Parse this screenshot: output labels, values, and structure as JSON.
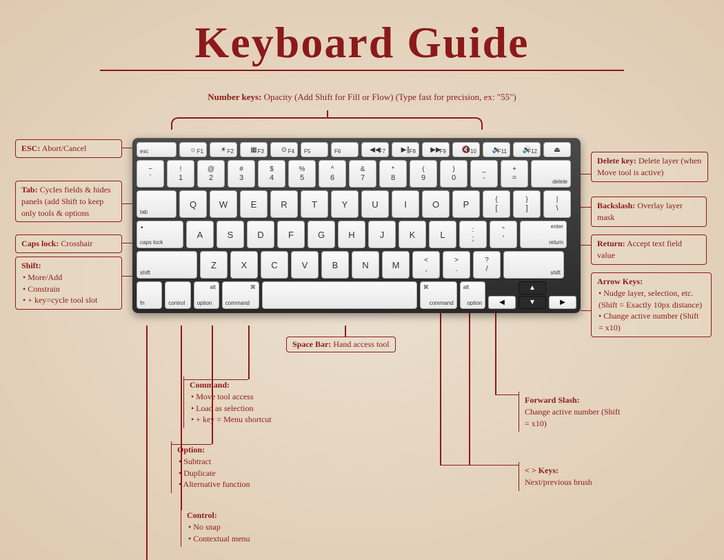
{
  "title": "Keyboard Guide",
  "number_keys": {
    "label": "Number keys:",
    "desc": "Opacity (Add Shift for Fill or Flow) (Type fast for precision, ex: \"55\")"
  },
  "callouts": {
    "esc": {
      "label": "ESC:",
      "desc": "Abort/Cancel"
    },
    "tab": {
      "label": "Tab:",
      "desc": "Cycles fields & hides panels (add Shift to keep only tools & options"
    },
    "caps": {
      "label": "Caps lock:",
      "desc": "Crosshair"
    },
    "shift": {
      "label": "Shift:",
      "items": [
        "More/Add",
        "Constrain",
        "+ key=cycle tool slot"
      ]
    },
    "command": {
      "label": "Command:",
      "items": [
        "Move tool access",
        "Load as selection",
        "+ key = Menu shortcut"
      ]
    },
    "option": {
      "label": "Option:",
      "items": [
        "Subtract",
        "Duplicate",
        "Alternative function"
      ]
    },
    "control": {
      "label": "Control:",
      "items": [
        "No snap",
        "Contextual menu"
      ]
    },
    "delete": {
      "label": "Delete key:",
      "desc": "Delete layer (when Move tool is active)"
    },
    "backslash": {
      "label": "Backslash:",
      "desc": "Overlay layer mask"
    },
    "return": {
      "label": "Return:",
      "desc": "Accept text field value"
    },
    "arrows": {
      "label": "Arrow Keys:",
      "items": [
        "Nudge layer, selection, etc. (Shift = Exactly 10px distance)",
        "Change active number (Shift = x10)"
      ]
    },
    "fslash": {
      "label": "Forward Slash:",
      "desc": "Change active number (Shift = x10)"
    },
    "angle": {
      "label": "< > Keys:",
      "desc": "Next/previous brush"
    },
    "space": {
      "label": "Space Bar:",
      "desc": "Hand access tool"
    }
  },
  "frow": [
    {
      "name": "esc",
      "label": "esc"
    },
    {
      "name": "f1",
      "sym": "☼",
      "label": "F1"
    },
    {
      "name": "f2",
      "sym": "☀",
      "label": "F2"
    },
    {
      "name": "f3",
      "sym": "▦",
      "label": "F3"
    },
    {
      "name": "f4",
      "sym": "⊙",
      "label": "F4"
    },
    {
      "name": "f5",
      "sym": "",
      "label": "F5"
    },
    {
      "name": "f6",
      "sym": "",
      "label": "F6"
    },
    {
      "name": "f7",
      "sym": "◀◀",
      "label": "F7"
    },
    {
      "name": "f8",
      "sym": "▶∥",
      "label": "F8"
    },
    {
      "name": "f9",
      "sym": "▶▶",
      "label": "F9"
    },
    {
      "name": "f10",
      "sym": "🔇",
      "label": "F10"
    },
    {
      "name": "f11",
      "sym": "🔉",
      "label": "F11"
    },
    {
      "name": "f12",
      "sym": "🔊",
      "label": "F12"
    },
    {
      "name": "eject",
      "sym": "⏏",
      "label": ""
    }
  ],
  "row1": [
    {
      "t": "~",
      "b": "`"
    },
    {
      "t": "!",
      "b": "1"
    },
    {
      "t": "@",
      "b": "2"
    },
    {
      "t": "#",
      "b": "3"
    },
    {
      "t": "$",
      "b": "4"
    },
    {
      "t": "%",
      "b": "5"
    },
    {
      "t": "^",
      "b": "6"
    },
    {
      "t": "&",
      "b": "7"
    },
    {
      "t": "*",
      "b": "8"
    },
    {
      "t": "(",
      "b": "9"
    },
    {
      "t": ")",
      "b": "0"
    },
    {
      "t": "_",
      "b": "-"
    },
    {
      "t": "+",
      "b": "="
    }
  ],
  "row1_delete": "delete",
  "row2_tab": "tab",
  "row2": [
    "Q",
    "W",
    "E",
    "R",
    "T",
    "Y",
    "U",
    "I",
    "O",
    "P"
  ],
  "row2_end": [
    {
      "t": "{",
      "b": "["
    },
    {
      "t": "}",
      "b": "]"
    },
    {
      "t": "|",
      "b": "\\"
    }
  ],
  "row3_caps": "caps lock",
  "row3": [
    "A",
    "S",
    "D",
    "F",
    "G",
    "H",
    "J",
    "K",
    "L"
  ],
  "row3_end": [
    {
      "t": ":",
      "b": ";"
    },
    {
      "t": "\"",
      "b": "'"
    }
  ],
  "row3_enter": {
    "top": "enter",
    "bot": "return"
  },
  "row4_shift": "shift",
  "row4": [
    "Z",
    "X",
    "C",
    "V",
    "B",
    "N",
    "M"
  ],
  "row4_end": [
    {
      "t": "<",
      "b": ","
    },
    {
      "t": ">",
      "b": "."
    },
    {
      "t": "?",
      "b": "/"
    }
  ],
  "row5": {
    "fn": "fn",
    "control": "control",
    "option": "option",
    "command": "command",
    "alt": "alt",
    "cmd_sym": "⌘"
  }
}
